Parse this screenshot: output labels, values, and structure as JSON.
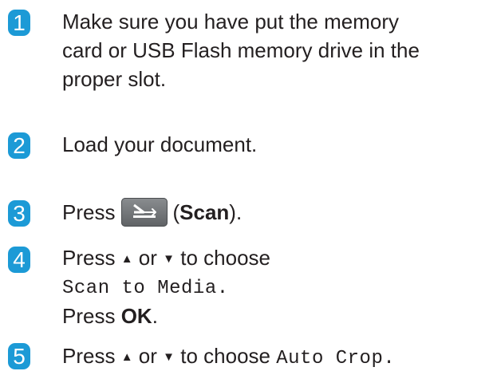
{
  "steps": [
    {
      "number": "1",
      "lines": [
        "Make sure you have put the memory",
        "card or USB Flash memory drive in the",
        "proper slot."
      ]
    },
    {
      "number": "2",
      "text": "Load your document."
    },
    {
      "number": "3",
      "press": "Press",
      "open_paren": "(",
      "key_label": "Scan",
      "close": ")."
    },
    {
      "number": "4",
      "press": "Press",
      "up_arrow": "▲",
      "or": "or",
      "down_arrow": "▼",
      "to_choose": "to choose",
      "option": "Scan to Media.",
      "press2": "Press",
      "ok": "OK",
      "period": "."
    },
    {
      "number": "5",
      "press": "Press",
      "up_arrow": "▲",
      "or": "or",
      "down_arrow": "▼",
      "to_choose": "to choose",
      "option": "Auto Crop."
    }
  ]
}
